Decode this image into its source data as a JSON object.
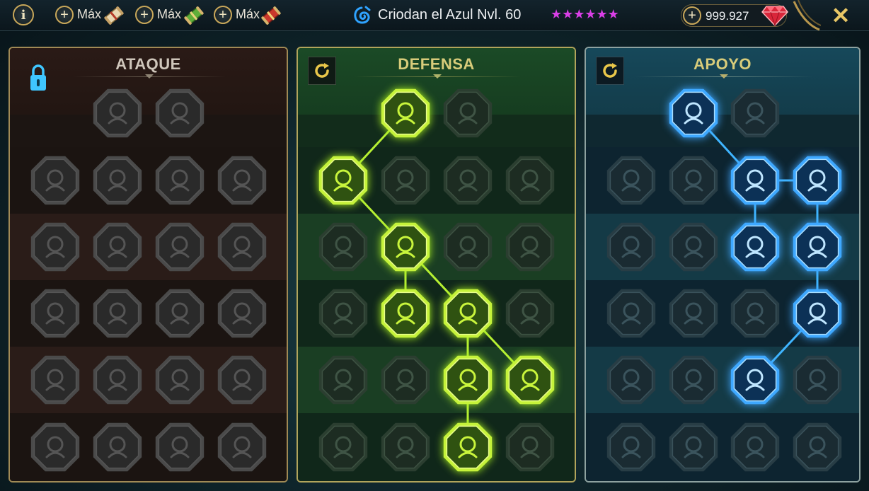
{
  "topbar": {
    "info_label": "i",
    "boosts": [
      {
        "label": "Máx",
        "icon": "parchment-scroll-icon"
      },
      {
        "label": "Máx",
        "icon": "green-scroll-icon"
      },
      {
        "label": "Máx",
        "icon": "red-scroll-icon"
      }
    ],
    "hero_name": "Criodan el Azul Nvl. 60",
    "hero_icon": "affinity-magic-icon",
    "stars": "★★★★★★",
    "gems": "999.927",
    "gem_icon": "ruby-gem-icon",
    "close_label": "✕"
  },
  "panels": [
    {
      "id": "ataque",
      "title": "ATAQUE",
      "title_color": "#cfc6bb",
      "locked": true,
      "rows": [
        [
          "crossed-swords-icon",
          "claw-slash-icon"
        ],
        [
          "demon-heart-icon",
          "sword-cloak-icon",
          "shield-arrow-icon",
          "bleeding-heart-icon"
        ],
        [
          "knight-horse-icon",
          "fangs-icon",
          "skull-slash-icon",
          "scythe-icon"
        ],
        [
          "heart-lock-icon",
          "fist-strike-icon",
          "axe-icon",
          "lightning-chain-icon"
        ],
        [
          "broken-crossbow-icon",
          "skull-icon",
          "dagger-shield-icon",
          "flexing-warrior-icon"
        ],
        [
          "sword-spark-icon",
          "helmet-icon",
          "horned-demon-icon",
          "skull-helm-icon"
        ]
      ]
    },
    {
      "id": "defensa",
      "title": "DEFENSA",
      "title_color": "#d8cc7a",
      "locked": false,
      "rows": [
        [
          {
            "icon": "armor-plates-icon",
            "active": true
          },
          {
            "icon": "raised-fist-icon",
            "active": false
          }
        ],
        [
          {
            "icon": "chevron-shield-icon",
            "active": true
          },
          {
            "icon": "anatomical-heart-icon",
            "active": false
          },
          {
            "icon": "wounded-giant-icon",
            "active": false
          },
          {
            "icon": "broken-blade-icon",
            "active": false
          }
        ],
        [
          {
            "icon": "hooded-figure-icon",
            "active": false
          },
          {
            "icon": "knight-shield-icon",
            "active": true
          },
          {
            "icon": "skull-heart-icon",
            "active": false
          },
          {
            "icon": "bald-head-icon",
            "active": false
          }
        ],
        [
          {
            "icon": "silhouette-crowd-icon",
            "active": false
          },
          {
            "icon": "hourglass-icon",
            "active": true
          },
          {
            "icon": "hand-drop-icon",
            "active": true
          },
          {
            "icon": "bull-head-icon",
            "active": false
          }
        ],
        [
          {
            "icon": "running-man-icon",
            "active": false
          },
          {
            "icon": "triple-drop-icon",
            "active": false
          },
          {
            "icon": "sun-skull-icon",
            "active": true
          },
          {
            "icon": "healing-hand-icon",
            "active": true
          }
        ],
        [
          {
            "icon": "armored-knight-icon",
            "active": false
          },
          {
            "icon": "winged-shield-icon",
            "active": false
          },
          {
            "icon": "spiked-skull-icon",
            "active": true
          },
          {
            "icon": "strongman-icon",
            "active": false
          }
        ]
      ]
    },
    {
      "id": "apoyo",
      "title": "APOYO",
      "title_color": "#d8cc7a",
      "locked": false,
      "rows": [
        [
          {
            "icon": "heart-plus-icon",
            "active": true
          },
          {
            "icon": "swirl-shield-icon",
            "active": false
          }
        ],
        [
          {
            "icon": "praying-hands-icon",
            "active": false
          },
          {
            "icon": "rune-shield-icon",
            "active": false
          },
          {
            "icon": "flaming-skull-icon",
            "active": true
          },
          {
            "icon": "reaching-hand-icon",
            "active": true
          }
        ],
        [
          {
            "icon": "sparkle-person-icon",
            "active": false
          },
          {
            "icon": "lightning-shield-icon",
            "active": false
          },
          {
            "icon": "shattered-ground-icon",
            "active": true
          },
          {
            "icon": "shadow-figure-icon",
            "active": true
          }
        ],
        [
          {
            "icon": "heart-chain-icon",
            "active": false
          },
          {
            "icon": "meteor-icon",
            "active": false
          },
          {
            "icon": "open-book-icon",
            "active": false
          },
          {
            "icon": "glaring-eyes-icon",
            "active": true
          }
        ],
        [
          {
            "icon": "compass-star-icon",
            "active": false
          },
          {
            "icon": "winged-boot-icon",
            "active": false
          },
          {
            "icon": "seeing-eye-icon",
            "active": true
          },
          {
            "icon": "tangled-figure-icon",
            "active": false
          }
        ],
        [
          {
            "icon": "poison-flask-icon",
            "active": false
          },
          {
            "icon": "grim-skull-icon",
            "active": false
          },
          {
            "icon": "gauntlet-skull-icon",
            "active": false
          },
          {
            "icon": "eagle-head-icon",
            "active": false
          }
        ]
      ]
    }
  ],
  "colors": {
    "defense_accent": "#b6f032",
    "support_accent": "#3fb5ff",
    "locked_node": "#3a3a3a",
    "star_color": "#d93fe6"
  }
}
